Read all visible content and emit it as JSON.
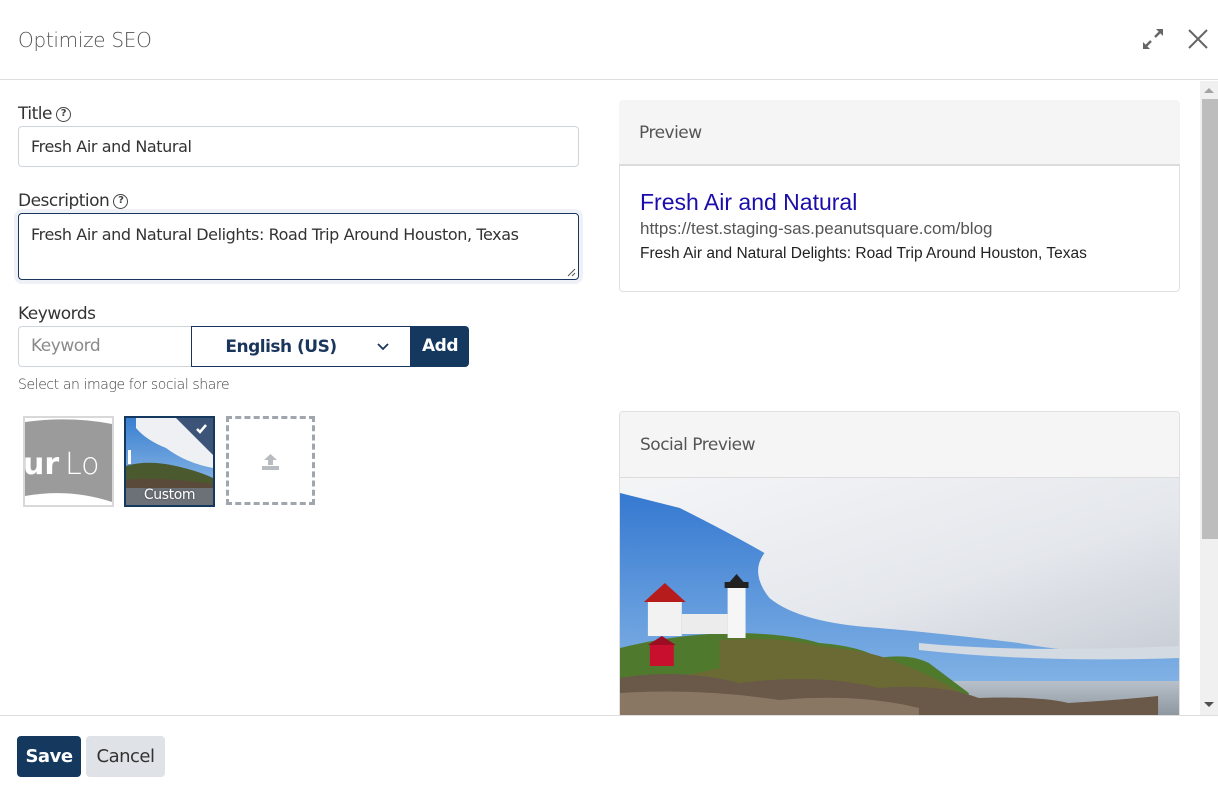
{
  "header": {
    "title": "Optimize SEO",
    "expand_icon": "expand-arrows-icon",
    "close_icon": "close-x-icon"
  },
  "form": {
    "title_label": "Title",
    "title_value": "Fresh Air and Natural",
    "description_label": "Description",
    "description_value": "Fresh Air and Natural Delights: Road Trip Around Houston, Texas",
    "help_glyph": "?",
    "keywords_label": "Keywords",
    "keyword_placeholder": "Keyword",
    "language_selected": "English (US)",
    "add_label": "Add",
    "image_hint": "Select an image for social share",
    "images": [
      {
        "name": "logo",
        "text": "urLo",
        "selected": false
      },
      {
        "name": "custom",
        "label": "Custom",
        "selected": true
      },
      {
        "name": "upload",
        "icon": "upload-icon"
      }
    ]
  },
  "preview": {
    "heading": "Preview",
    "serp_title": "Fresh Air and Natural",
    "serp_url": "https://test.staging-sas.peanutsquare.com/blog",
    "serp_description": "Fresh Air and Natural Delights: Road Trip Around Houston, Texas"
  },
  "social_preview": {
    "heading": "Social Preview",
    "image_alt": "Lighthouse on rocky coast under cloudy blue sky"
  },
  "footer": {
    "save_label": "Save",
    "cancel_label": "Cancel"
  },
  "colors": {
    "primary": "#15385f",
    "link": "#1a0dab"
  }
}
